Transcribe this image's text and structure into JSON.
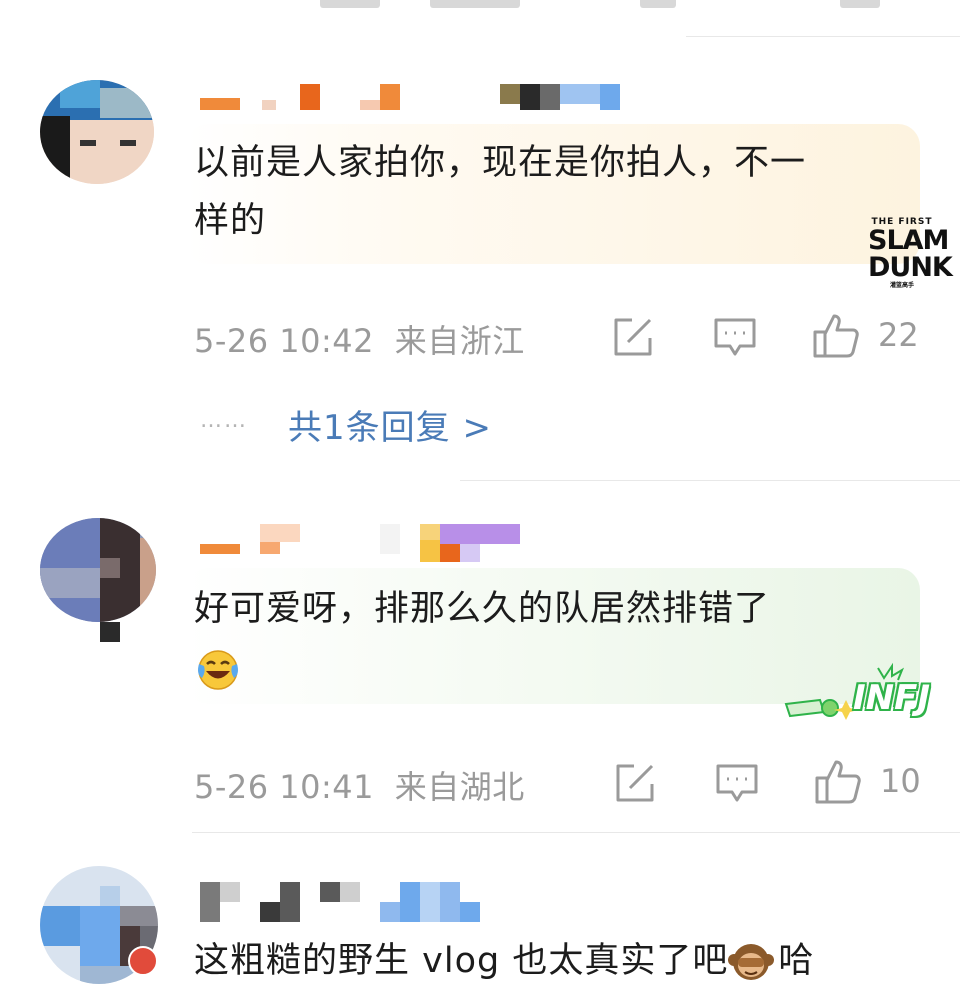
{
  "comments": [
    {
      "text_line1": "以前是人家拍你，现在是你拍人，不一",
      "text_line2": "样的",
      "time": "5-26 10:42",
      "location": "来自浙江",
      "likes": "22",
      "reply_link": "共1条回复 >",
      "reply_dots": "……",
      "badge_line1": "THE FIRST",
      "badge_line2": "SLAM",
      "badge_line3": "DUNK",
      "badge_line4": "灌篮高手"
    },
    {
      "text_line1": "好可爱呀，排那么久的队居然排错了",
      "time": "5-26 10:41",
      "location": "来自湖北",
      "likes": "10",
      "emoji_icon": "laughing-crying-icon",
      "badge_text": "INFJ"
    },
    {
      "text_line1": "这粗糙的野生 vlog 也太真实了吧",
      "text_suffix": "哈",
      "emoji_icon": "see-no-evil-monkey-icon"
    }
  ],
  "colors": {
    "reply_link": "#4a7bb7",
    "meta_gray": "#9a9a9a",
    "bubble_warm": "#fdf6e8",
    "bubble_green": "#eef7ec"
  }
}
